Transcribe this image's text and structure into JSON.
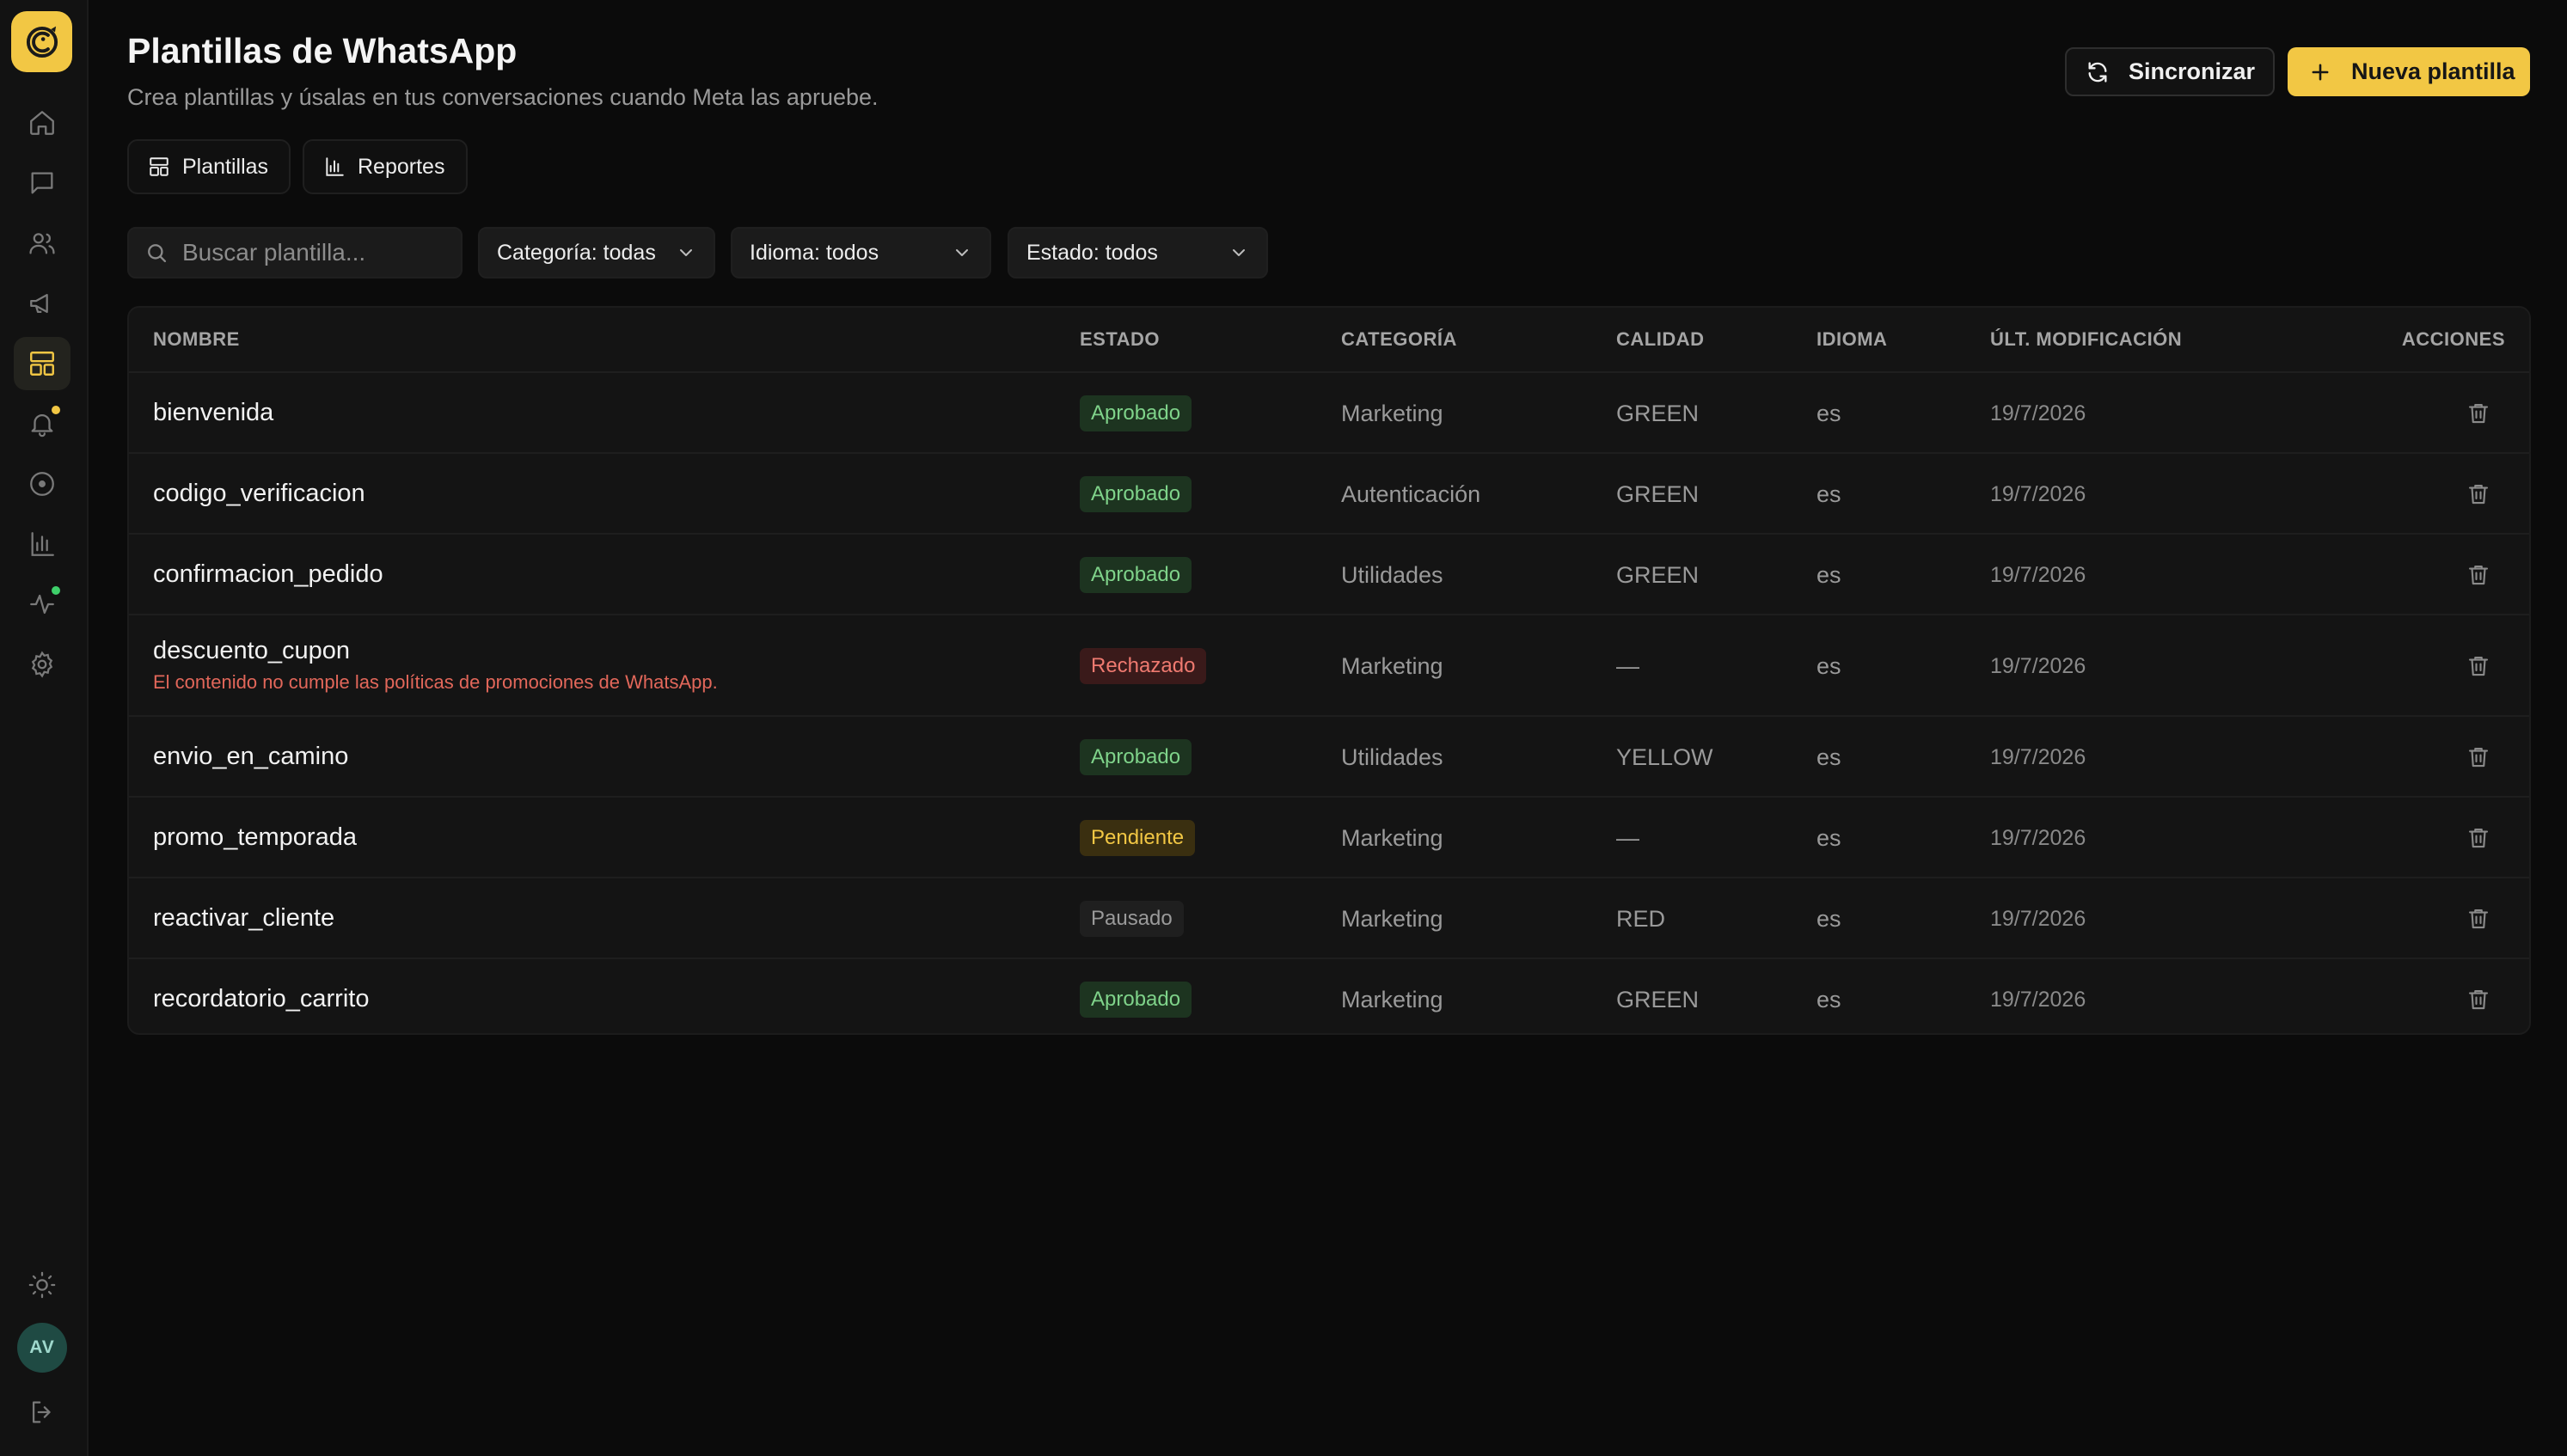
{
  "app": {
    "brand": "logo-icon"
  },
  "sidebar": {
    "items": [
      {
        "name": "home",
        "icon": "home-icon"
      },
      {
        "name": "chats",
        "icon": "message-icon"
      },
      {
        "name": "contacts",
        "icon": "users-icon"
      },
      {
        "name": "campaigns",
        "icon": "megaphone-icon"
      },
      {
        "name": "templates",
        "icon": "layout-icon",
        "active": true
      },
      {
        "name": "notifications",
        "icon": "bell-icon",
        "dot": "#f2c744"
      },
      {
        "name": "status",
        "icon": "circle-dot-icon"
      },
      {
        "name": "analytics",
        "icon": "bar-chart-icon"
      },
      {
        "name": "activity",
        "icon": "activity-icon",
        "dot": "#3ecf6a"
      },
      {
        "name": "settings",
        "icon": "gear-icon"
      }
    ],
    "avatar_initials": "AV"
  },
  "header": {
    "title": "Plantillas de WhatsApp",
    "subtitle": "Crea plantillas y úsalas en tus conversaciones cuando Meta las apruebe.",
    "sync_label": "Sincronizar",
    "new_label": "Nueva plantilla"
  },
  "tabs": [
    {
      "label": "Plantillas",
      "icon": "layout-icon"
    },
    {
      "label": "Reportes",
      "icon": "bar-chart-icon"
    }
  ],
  "filters": {
    "search_placeholder": "Buscar plantilla...",
    "category": "Categoría: todas",
    "language": "Idioma: todos",
    "status": "Estado: todos"
  },
  "table": {
    "columns": [
      "NOMBRE",
      "ESTADO",
      "CATEGORÍA",
      "CALIDAD",
      "IDIOMA",
      "ÚLT. MODIFICACIÓN",
      "ACCIONES"
    ],
    "rows": [
      {
        "name": "bienvenida",
        "status": "Aprobado",
        "status_tone": "green",
        "category": "Marketing",
        "quality": "GREEN",
        "language": "es",
        "modified": "19/7/2026"
      },
      {
        "name": "codigo_verificacion",
        "status": "Aprobado",
        "status_tone": "green",
        "category": "Autenticación",
        "quality": "GREEN",
        "language": "es",
        "modified": "19/7/2026"
      },
      {
        "name": "confirmacion_pedido",
        "status": "Aprobado",
        "status_tone": "green",
        "category": "Utilidades",
        "quality": "GREEN",
        "language": "es",
        "modified": "19/7/2026"
      },
      {
        "name": "descuento_cupon",
        "error": "El contenido no cumple las políticas de promociones de WhatsApp.",
        "status": "Rechazado",
        "status_tone": "red",
        "category": "Marketing",
        "quality": "—",
        "language": "es",
        "modified": "19/7/2026"
      },
      {
        "name": "envio_en_camino",
        "status": "Aprobado",
        "status_tone": "green",
        "category": "Utilidades",
        "quality": "YELLOW",
        "language": "es",
        "modified": "19/7/2026"
      },
      {
        "name": "promo_temporada",
        "status": "Pendiente",
        "status_tone": "yellow",
        "category": "Marketing",
        "quality": "—",
        "language": "es",
        "modified": "19/7/2026"
      },
      {
        "name": "reactivar_cliente",
        "status": "Pausado",
        "status_tone": "gray",
        "category": "Marketing",
        "quality": "RED",
        "language": "es",
        "modified": "19/7/2026"
      },
      {
        "name": "recordatorio_carrito",
        "status": "Aprobado",
        "status_tone": "green",
        "category": "Marketing",
        "quality": "GREEN",
        "language": "es",
        "modified": "19/7/2026"
      }
    ]
  }
}
